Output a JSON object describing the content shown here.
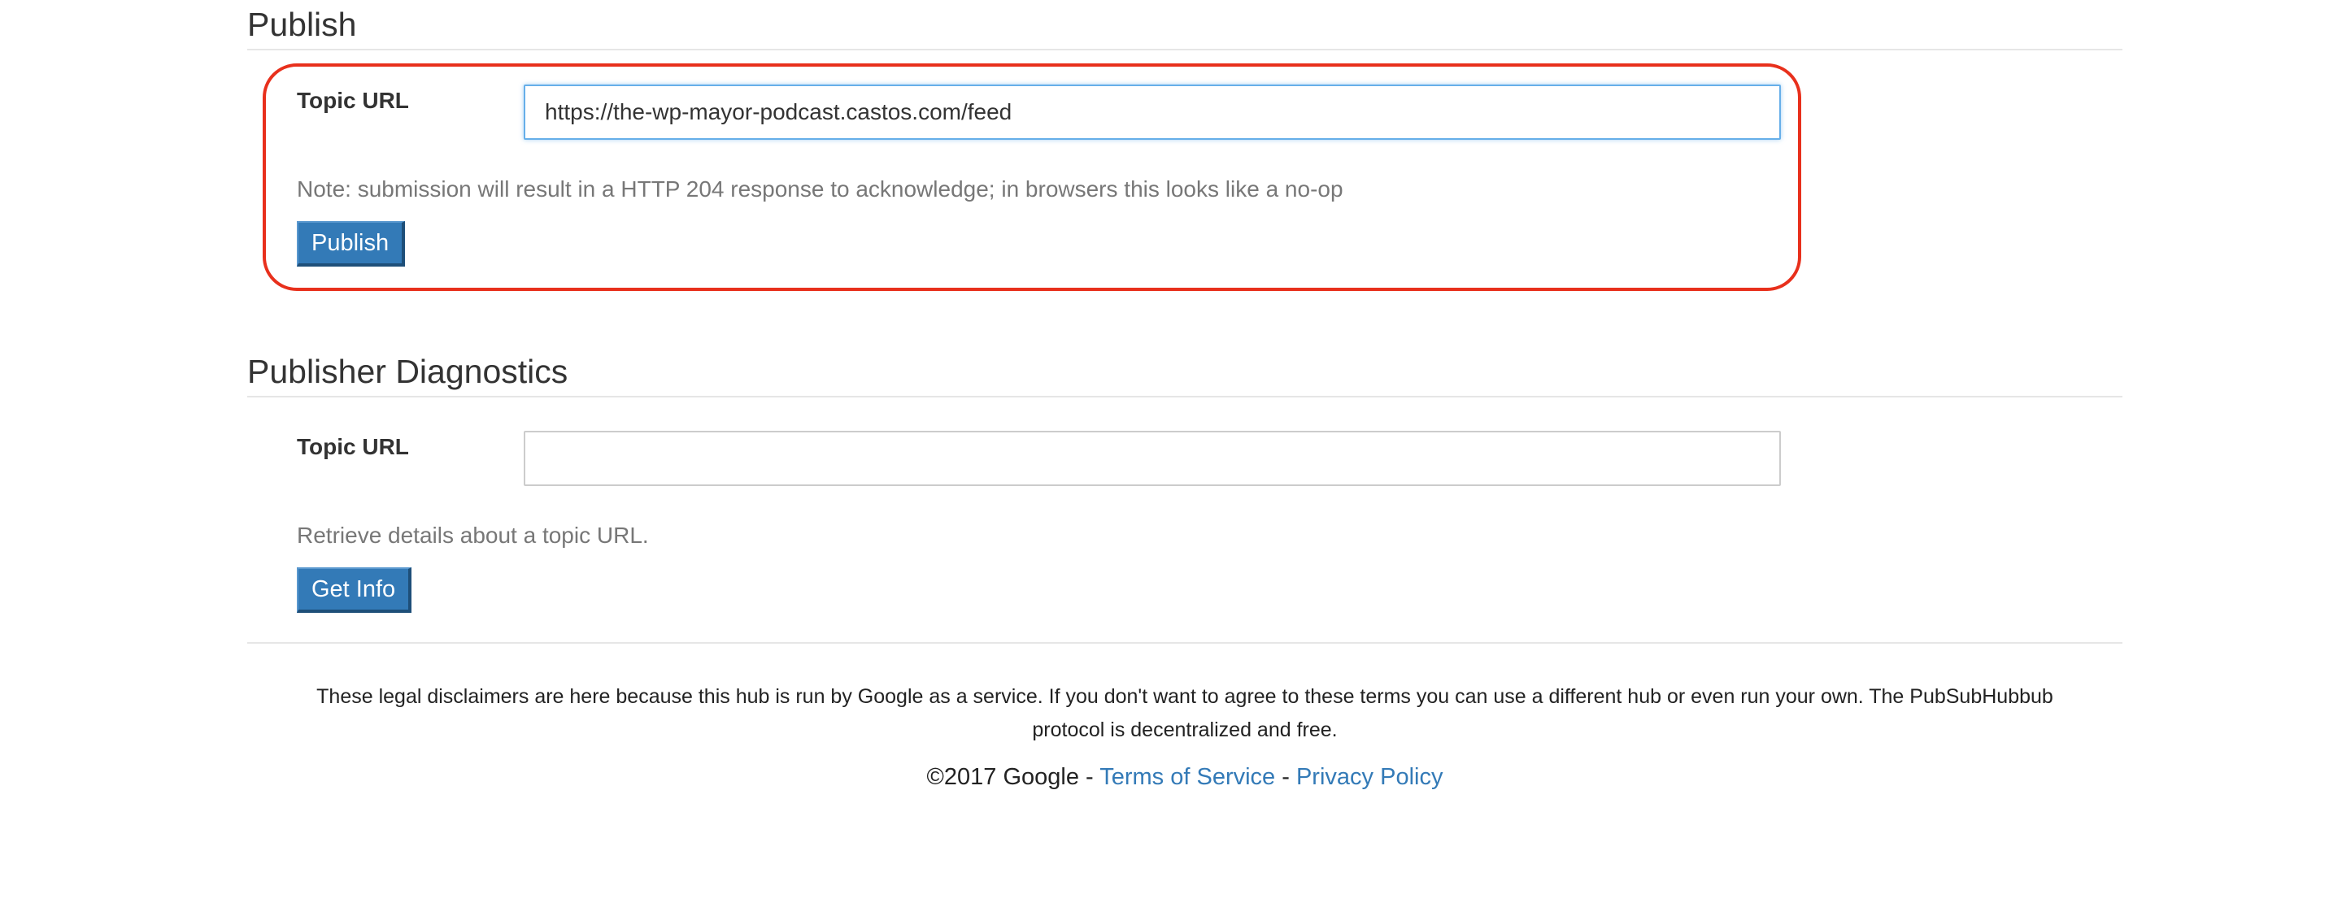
{
  "publish": {
    "title": "Publish",
    "topic_label": "Topic URL",
    "topic_value": "https://the-wp-mayor-podcast.castos.com/feed",
    "note": "Note: submission will result in a HTTP 204 response to acknowledge; in browsers this looks like a no-op",
    "button_label": "Publish"
  },
  "diagnostics": {
    "title": "Publisher Diagnostics",
    "topic_label": "Topic URL",
    "topic_value": "",
    "help": "Retrieve details about a topic URL.",
    "button_label": "Get Info"
  },
  "footer": {
    "disclaimer": "These legal disclaimers are here because this hub is run by Google as a service. If you don't want to agree to these terms you can use a different hub or even run your own. The PubSubHubbub protocol is decentralized and free.",
    "copyright": "©2017 Google",
    "separator": " - ",
    "terms_label": "Terms of Service",
    "privacy_label": "Privacy Policy"
  },
  "colors": {
    "link": "#337ab7",
    "button": "#337ab7",
    "highlight": "#e8301c",
    "focus": "#66afe9"
  }
}
